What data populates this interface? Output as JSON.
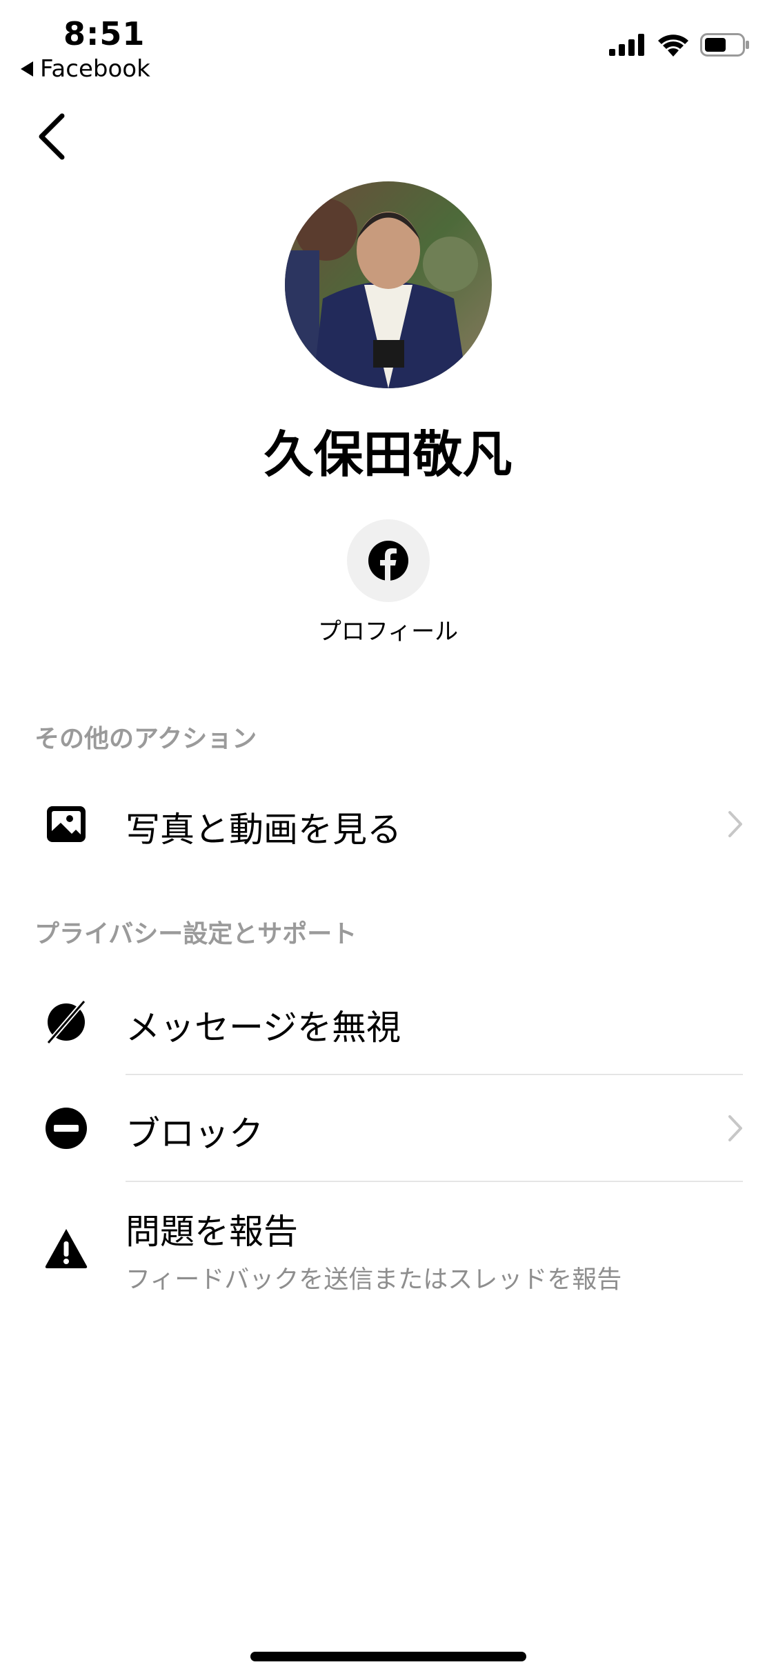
{
  "status_bar": {
    "time": "8:51",
    "back_app": "Facebook",
    "icons": [
      "signal-icon",
      "wifi-icon",
      "battery-icon"
    ]
  },
  "contact": {
    "name": "久保田敬凡"
  },
  "quick_actions": [
    {
      "label": "プロフィール",
      "icon": "facebook-icon"
    }
  ],
  "sections": {
    "other_actions": {
      "title": "その他のアクション",
      "items": [
        {
          "label": "写真と動画を見る",
          "icon": "photo-icon",
          "chevron": true
        }
      ]
    },
    "privacy": {
      "title": "プライバシー設定とサポート",
      "items": [
        {
          "label": "メッセージを無視",
          "icon": "ignore-icon"
        },
        {
          "label": "ブロック",
          "icon": "block-icon",
          "chevron": true
        },
        {
          "label": "問題を報告",
          "subtitle": "フィードバックを送信またはスレッドを報告",
          "icon": "warning-icon"
        }
      ]
    }
  },
  "colors": {
    "background": "#ffffff",
    "section_title": "#9a9a9a",
    "subtitle": "#8e8e8e",
    "divider": "#e5e5e5"
  }
}
